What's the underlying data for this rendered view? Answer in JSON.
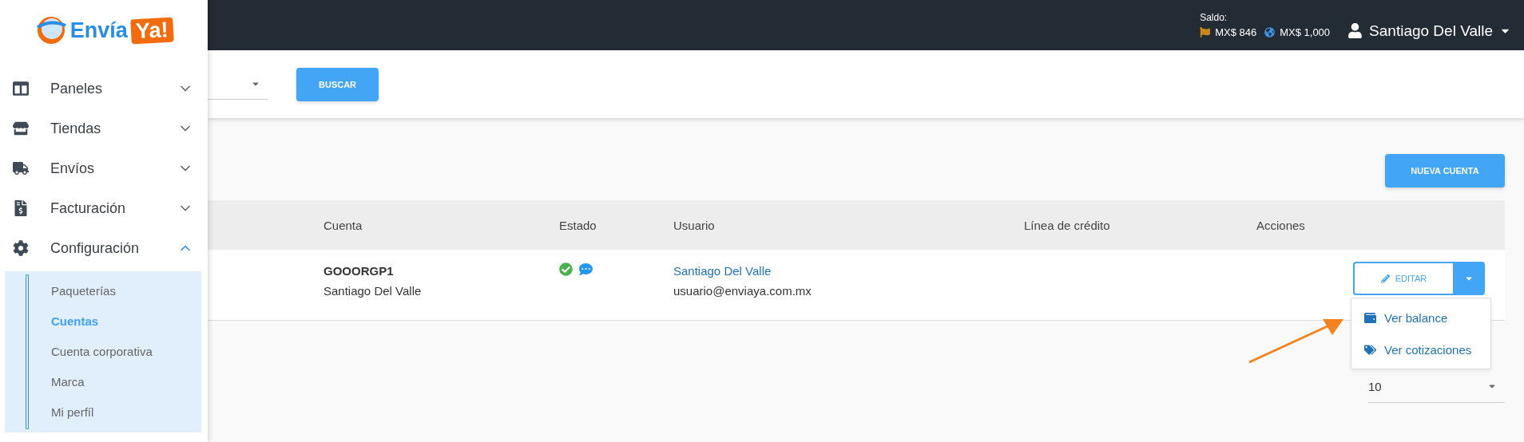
{
  "logo": {
    "text_main": "Envía",
    "text_badge": "Ya!"
  },
  "sidebar": {
    "items": [
      {
        "label": "Paneles",
        "kind": "panels",
        "expanded": false
      },
      {
        "label": "Tiendas",
        "kind": "store",
        "expanded": false
      },
      {
        "label": "Envíos",
        "kind": "truck",
        "expanded": false
      },
      {
        "label": "Facturación",
        "kind": "invoice",
        "expanded": false
      },
      {
        "label": "Configuración",
        "kind": "gear",
        "expanded": true,
        "children": [
          {
            "label": "Paqueterías",
            "selected": false
          },
          {
            "label": "Cuentas",
            "selected": true
          },
          {
            "label": "Cuenta corporativa",
            "selected": false
          },
          {
            "label": "Marca",
            "selected": false
          },
          {
            "label": "Mi perfíl",
            "selected": false
          }
        ]
      }
    ]
  },
  "header": {
    "balance_label": "Saldo:",
    "balances": [
      {
        "kind": "flag",
        "amount": "MX$ 846"
      },
      {
        "kind": "globe",
        "amount": "MX$ 1,000"
      }
    ],
    "user": "Santiago Del Valle"
  },
  "filter": {
    "button": "BUSCAR"
  },
  "new_button": "NUEVA CUENTA",
  "table": {
    "columns": [
      "Cuenta",
      "Estado",
      "Usuario",
      "Línea de crédito",
      "Acciones"
    ],
    "rows": [
      {
        "account_code": "GOOORGP1",
        "account_name": "Santiago Del Valle",
        "active": true,
        "has_messages": true,
        "user_name": "Santiago Del Valle",
        "user_email": "usuario@enviaya.com.mx",
        "edit_button": "EDITAR"
      }
    ]
  },
  "actions_menu": {
    "open": true,
    "items": [
      {
        "kind": "wallet",
        "label": "Ver balance"
      },
      {
        "kind": "tag",
        "label": "Ver cotizaciones"
      }
    ]
  },
  "per_page": {
    "value": "10"
  }
}
